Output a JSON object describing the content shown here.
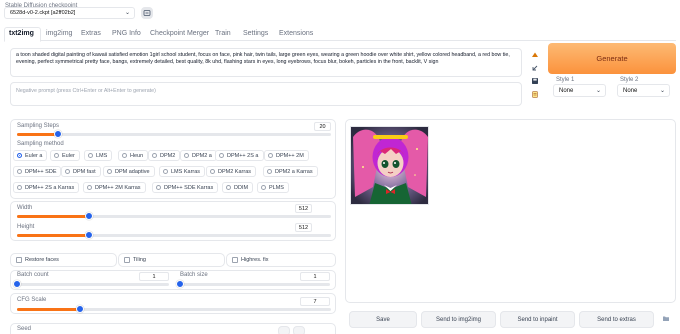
{
  "checkpoint": {
    "label": "Stable Diffusion checkpoint",
    "value": "6528d-v0-2.ckpt [a2ff02b2]"
  },
  "tabs": [
    "txt2img",
    "img2img",
    "Extras",
    "PNG Info",
    "Checkpoint Merger",
    "Train",
    "Settings",
    "Extensions"
  ],
  "prompt": {
    "value": "a toon shaded digital painting of kawaii satisfied emotion 1girl school student, focus on face, pink hair, twin tails, large green eyes, wearing a green hoodie over white shirt, yellow colored headband, a red bow tie, evening, perfect symmetrical pretty face, bangs, extremely detailed, best quality, 8k uhd,  flashing stars in eyes, long eyebrows, focus blur, bokeh, particles in the front, backlit, V sign",
    "negative_placeholder": "Negative prompt (press Ctrl+Enter or Alt+Enter to generate)"
  },
  "generate_label": "Generate",
  "styles": {
    "style1_label": "Style 1",
    "style1_value": "None",
    "style2_label": "Style 2",
    "style2_value": "None"
  },
  "sampling_steps": {
    "label": "Sampling Steps",
    "value": "20",
    "fraction": 0.13
  },
  "sampling_method": {
    "label": "Sampling method",
    "options": [
      "Euler a",
      "Euler",
      "LMS",
      "Heun",
      "DPM2",
      "DPM2 a",
      "DPM++ 2S a",
      "DPM++ 2M",
      "DPM++ SDE",
      "DPM fast",
      "DPM adaptive",
      "LMS Karras",
      "DPM2 Karras",
      "DPM2 a Karras",
      "DPM++ 2S a Karras",
      "DPM++ 2M Karras",
      "DPM++ SDE Karras",
      "DDIM",
      "PLMS"
    ],
    "selected": "Euler a"
  },
  "width": {
    "label": "Width",
    "value": "512",
    "fraction": 0.23
  },
  "height": {
    "label": "Height",
    "value": "512",
    "fraction": 0.23
  },
  "checkboxes": {
    "restore_faces": "Restore faces",
    "tiling": "Tiling",
    "highres_fix": "Highres. fix"
  },
  "batch_count": {
    "label": "Batch count",
    "value": "1",
    "fraction": 0.0
  },
  "batch_size": {
    "label": "Batch size",
    "value": "1",
    "fraction": 0.0
  },
  "cfg_scale": {
    "label": "CFG Scale",
    "value": "7",
    "fraction": 0.2
  },
  "seed": {
    "label": "Seed"
  },
  "actions": {
    "save": "Save",
    "send_img2img": "Send to img2img",
    "send_inpaint": "Send to inpaint",
    "send_extras": "Send to extras"
  },
  "colors": {
    "accent": "#f97316",
    "generate_bg": "#fdba74",
    "thumb": "#2563eb"
  },
  "icons": {
    "refresh": "refresh-icon",
    "paste": "paste-icon",
    "arrow": "arrow-icon",
    "save_style": "save-style-icon",
    "clipboard": "clipboard-icon",
    "folder": "folder-icon"
  }
}
